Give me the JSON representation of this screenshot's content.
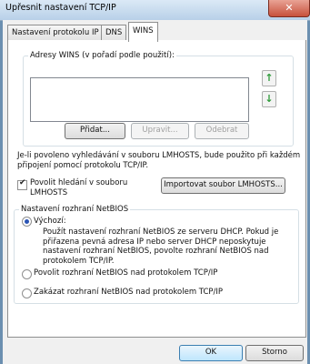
{
  "window": {
    "title": "Upřesnit nastavení TCP/IP",
    "close_glyph": "✕"
  },
  "tabs": [
    {
      "label": "Nastavení protokolu IP",
      "active": false
    },
    {
      "label": "DNS",
      "active": false
    },
    {
      "label": "WINS",
      "active": true
    }
  ],
  "wins": {
    "group_label": "Adresy WINS (v pořadí podle použití):",
    "list_items": [],
    "move_up_icon": "↑",
    "move_down_icon": "↓",
    "add_label": "Přidat...",
    "edit_label": "Upravit...",
    "remove_label": "Odebrat"
  },
  "lmhosts": {
    "info_lines": [
      "Je-li povoleno vyhledávání v souboru LMHOSTS, bude použito při každém",
      "připojení pomocí protokolu TCP/IP."
    ],
    "checkbox_lines": [
      "Povolit hledání v souboru",
      "LMHOSTS"
    ],
    "checkbox_checked": true,
    "import_label": "Importovat soubor LMHOSTS..."
  },
  "netbios": {
    "group_label": "Nastavení rozhraní NetBIOS",
    "default_label": "Výchozí:",
    "default_desc_lines": [
      "Použít nastavení rozhraní NetBIOS ze serveru DHCP. Pokud je",
      "přiřazena pevná adresa IP nebo server DHCP neposkytuje",
      "nastavení rozhraní NetBIOS, povolte rozhraní NetBIOS nad",
      "protokolem TCP/IP."
    ],
    "enable_label": "Povolit rozhraní NetBIOS nad protokolem TCP/IP",
    "disable_label": "Zakázat rozhraní NetBIOS nad protokolem TCP/IP",
    "selected": "default"
  },
  "footer": {
    "ok_label": "OK",
    "cancel_label": "Storno"
  }
}
